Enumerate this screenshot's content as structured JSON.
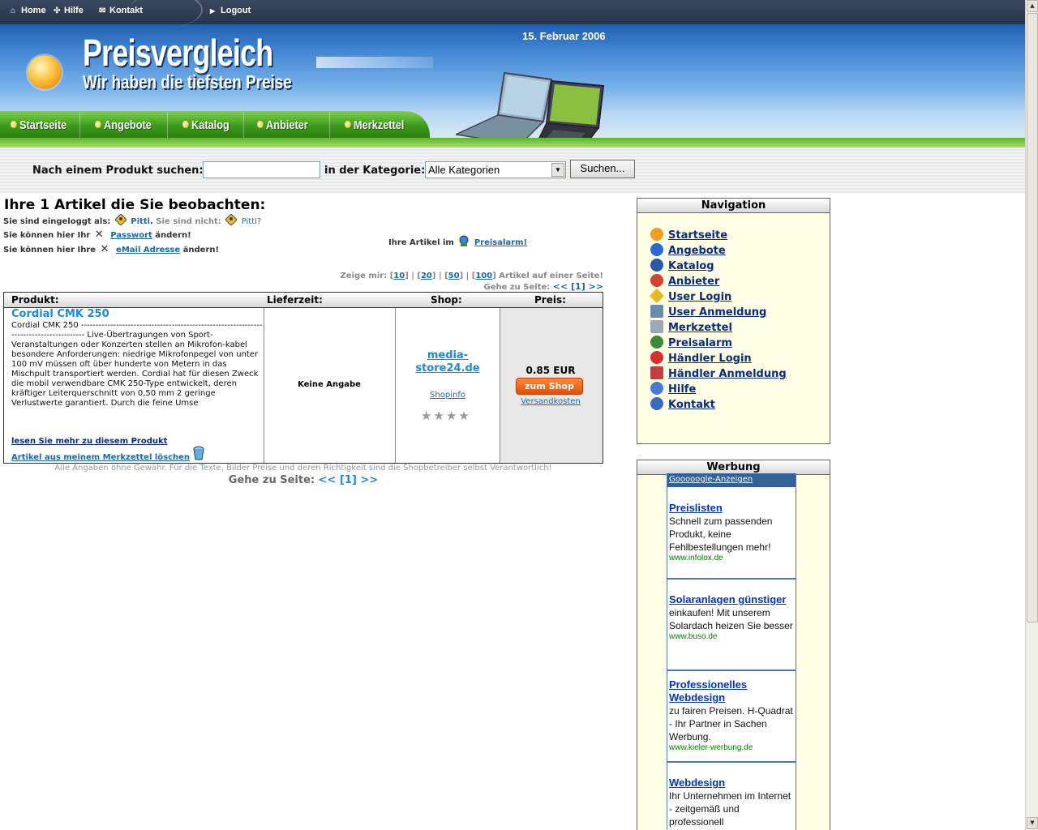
{
  "topbar": {
    "home": "Home",
    "hilfe": "Hilfe",
    "kontakt": "Kontakt",
    "logout": "Logout"
  },
  "header": {
    "date": "15. Februar 2006",
    "title": "Preisvergleich",
    "slogan": "Wir haben die tiefsten Preise"
  },
  "mainnav": [
    "Startseite",
    "Angebote",
    "Katalog",
    "Anbieter",
    "Merkzettel"
  ],
  "search": {
    "label": "Nach einem Produkt suchen:",
    "input_value": "",
    "category_label": "in der Kategorie:",
    "category_selected": "Alle Kategorien",
    "button": "Suchen..."
  },
  "main": {
    "heading": "Ihre 1 Artikel die Sie beobachten:",
    "logged_in_prefix": "Sie sind eingeloggt als:",
    "user": "Pitti",
    "not_prefix": "Sie sind nicht:",
    "not_user": "Pitti?",
    "password_prefix": "Sie können hier Ihr",
    "password_link": "Passwort",
    "password_suffix": "ändern!",
    "email_prefix": "Sie können hier Ihre",
    "email_link": "eMail Adresse",
    "email_suffix": "ändern!",
    "alarm_prefix": "Ihre Artikel im",
    "alarm_link": "Preisalarm!",
    "pager": {
      "show_label": "Zeige mir:",
      "options": [
        "10",
        "20",
        "50",
        "100"
      ],
      "suffix": "Artikel auf einer Seite!",
      "goto_label": "Gehe zu Seite:",
      "goto_links": "<< [1] >>"
    }
  },
  "table": {
    "headers": [
      "Produkt:",
      "Lieferzeit:",
      "Shop:",
      "Preis:"
    ],
    "product_name": "Cordial CMK 250",
    "description": "Cordial CMK 250 --------------------------------------------------------------------------------------- Live-Übertragungen von Sport-Veranstaltungen oder Konzerten stellen an Mikrofon-kabel besondere Anforderungen: niedrige Mikrofonpegel von unter 100 mV müssen oft über hunderte von Metern in das Mischpult transportiert werden. Cordial hat für diesen Zweck die mobil verwendbare CMK 250-Type entwickelt, deren kräftiger Leiterquerschnitt von 0,50 mm 2 geringe Verlustwerte garantiert. Durch die feine Umse",
    "more_link": "lesen Sie mehr zu diesem Produkt",
    "delete_link": "Artikel aus meinem Merkzettel löschen",
    "delivery": "Keine Angabe",
    "shop_name": "media-store24.de",
    "shopinfo": "Shopinfo",
    "rating": 4,
    "price": "0.85 EUR",
    "shop_button": "zum Shop",
    "shipping": "Versandkosten"
  },
  "footnote": "Alle Angaben ohne Gewähr. Für die Texte, Bilder Preise und deren Richtigkeit sind die Shopbetreiber selbst Verantwortlich!",
  "bottom_pager": {
    "label": "Gehe zu Seite:",
    "links": "<< [1] >>"
  },
  "sidebar": {
    "nav_title": "Navigation",
    "nav_items": [
      {
        "label": "Startseite",
        "icon": "home-icon",
        "color": "#f0a020"
      },
      {
        "label": "Angebote",
        "icon": "offers-icon",
        "color": "#2a6ad0"
      },
      {
        "label": "Katalog",
        "icon": "catalog-icon",
        "color": "#2a5aa8"
      },
      {
        "label": "Anbieter",
        "icon": "vendor-icon",
        "color": "#d84030"
      },
      {
        "label": "User Login",
        "icon": "user-login-icon",
        "color": "#e8b820"
      },
      {
        "label": "User Anmeldung",
        "icon": "user-register-icon",
        "color": "#6a8ab0"
      },
      {
        "label": "Merkzettel",
        "icon": "notepad-icon",
        "color": "#9aa8b8"
      },
      {
        "label": "Preisalarm",
        "icon": "alarm-icon",
        "color": "#3a8a3a"
      },
      {
        "label": "Händler Login",
        "icon": "dealer-login-icon",
        "color": "#d83030"
      },
      {
        "label": "Händler Anmeldung",
        "icon": "dealer-register-icon",
        "color": "#c04040"
      },
      {
        "label": "Hilfe",
        "icon": "help-icon",
        "color": "#4a7ad8"
      },
      {
        "label": "Kontakt",
        "icon": "contact-icon",
        "color": "#3a6ac0"
      }
    ],
    "ads_title": "Werbung",
    "ads_header": "Gooooogle-Anzeigen",
    "ads": [
      {
        "title": "Preislisten",
        "text": "Schnell zum passenden Produkt, keine Fehlbestellungen mehr!",
        "url": "www.infolox.de"
      },
      {
        "title": "Solaranlagen günstiger",
        "text": "einkaufen! Mit unserem Solardach heizen Sie besser",
        "url": "www.buso.de"
      },
      {
        "title": "Professionelles Webdesign",
        "text": "zu fairen Preisen. H-Quadrat - Ihr Partner in Sachen Werbung.",
        "url": "www.kieler-werbung.de"
      },
      {
        "title": "Webdesign",
        "text": "Ihr Unternehmen im Internet - zeitgemäß und professionell",
        "url": ""
      }
    ]
  }
}
